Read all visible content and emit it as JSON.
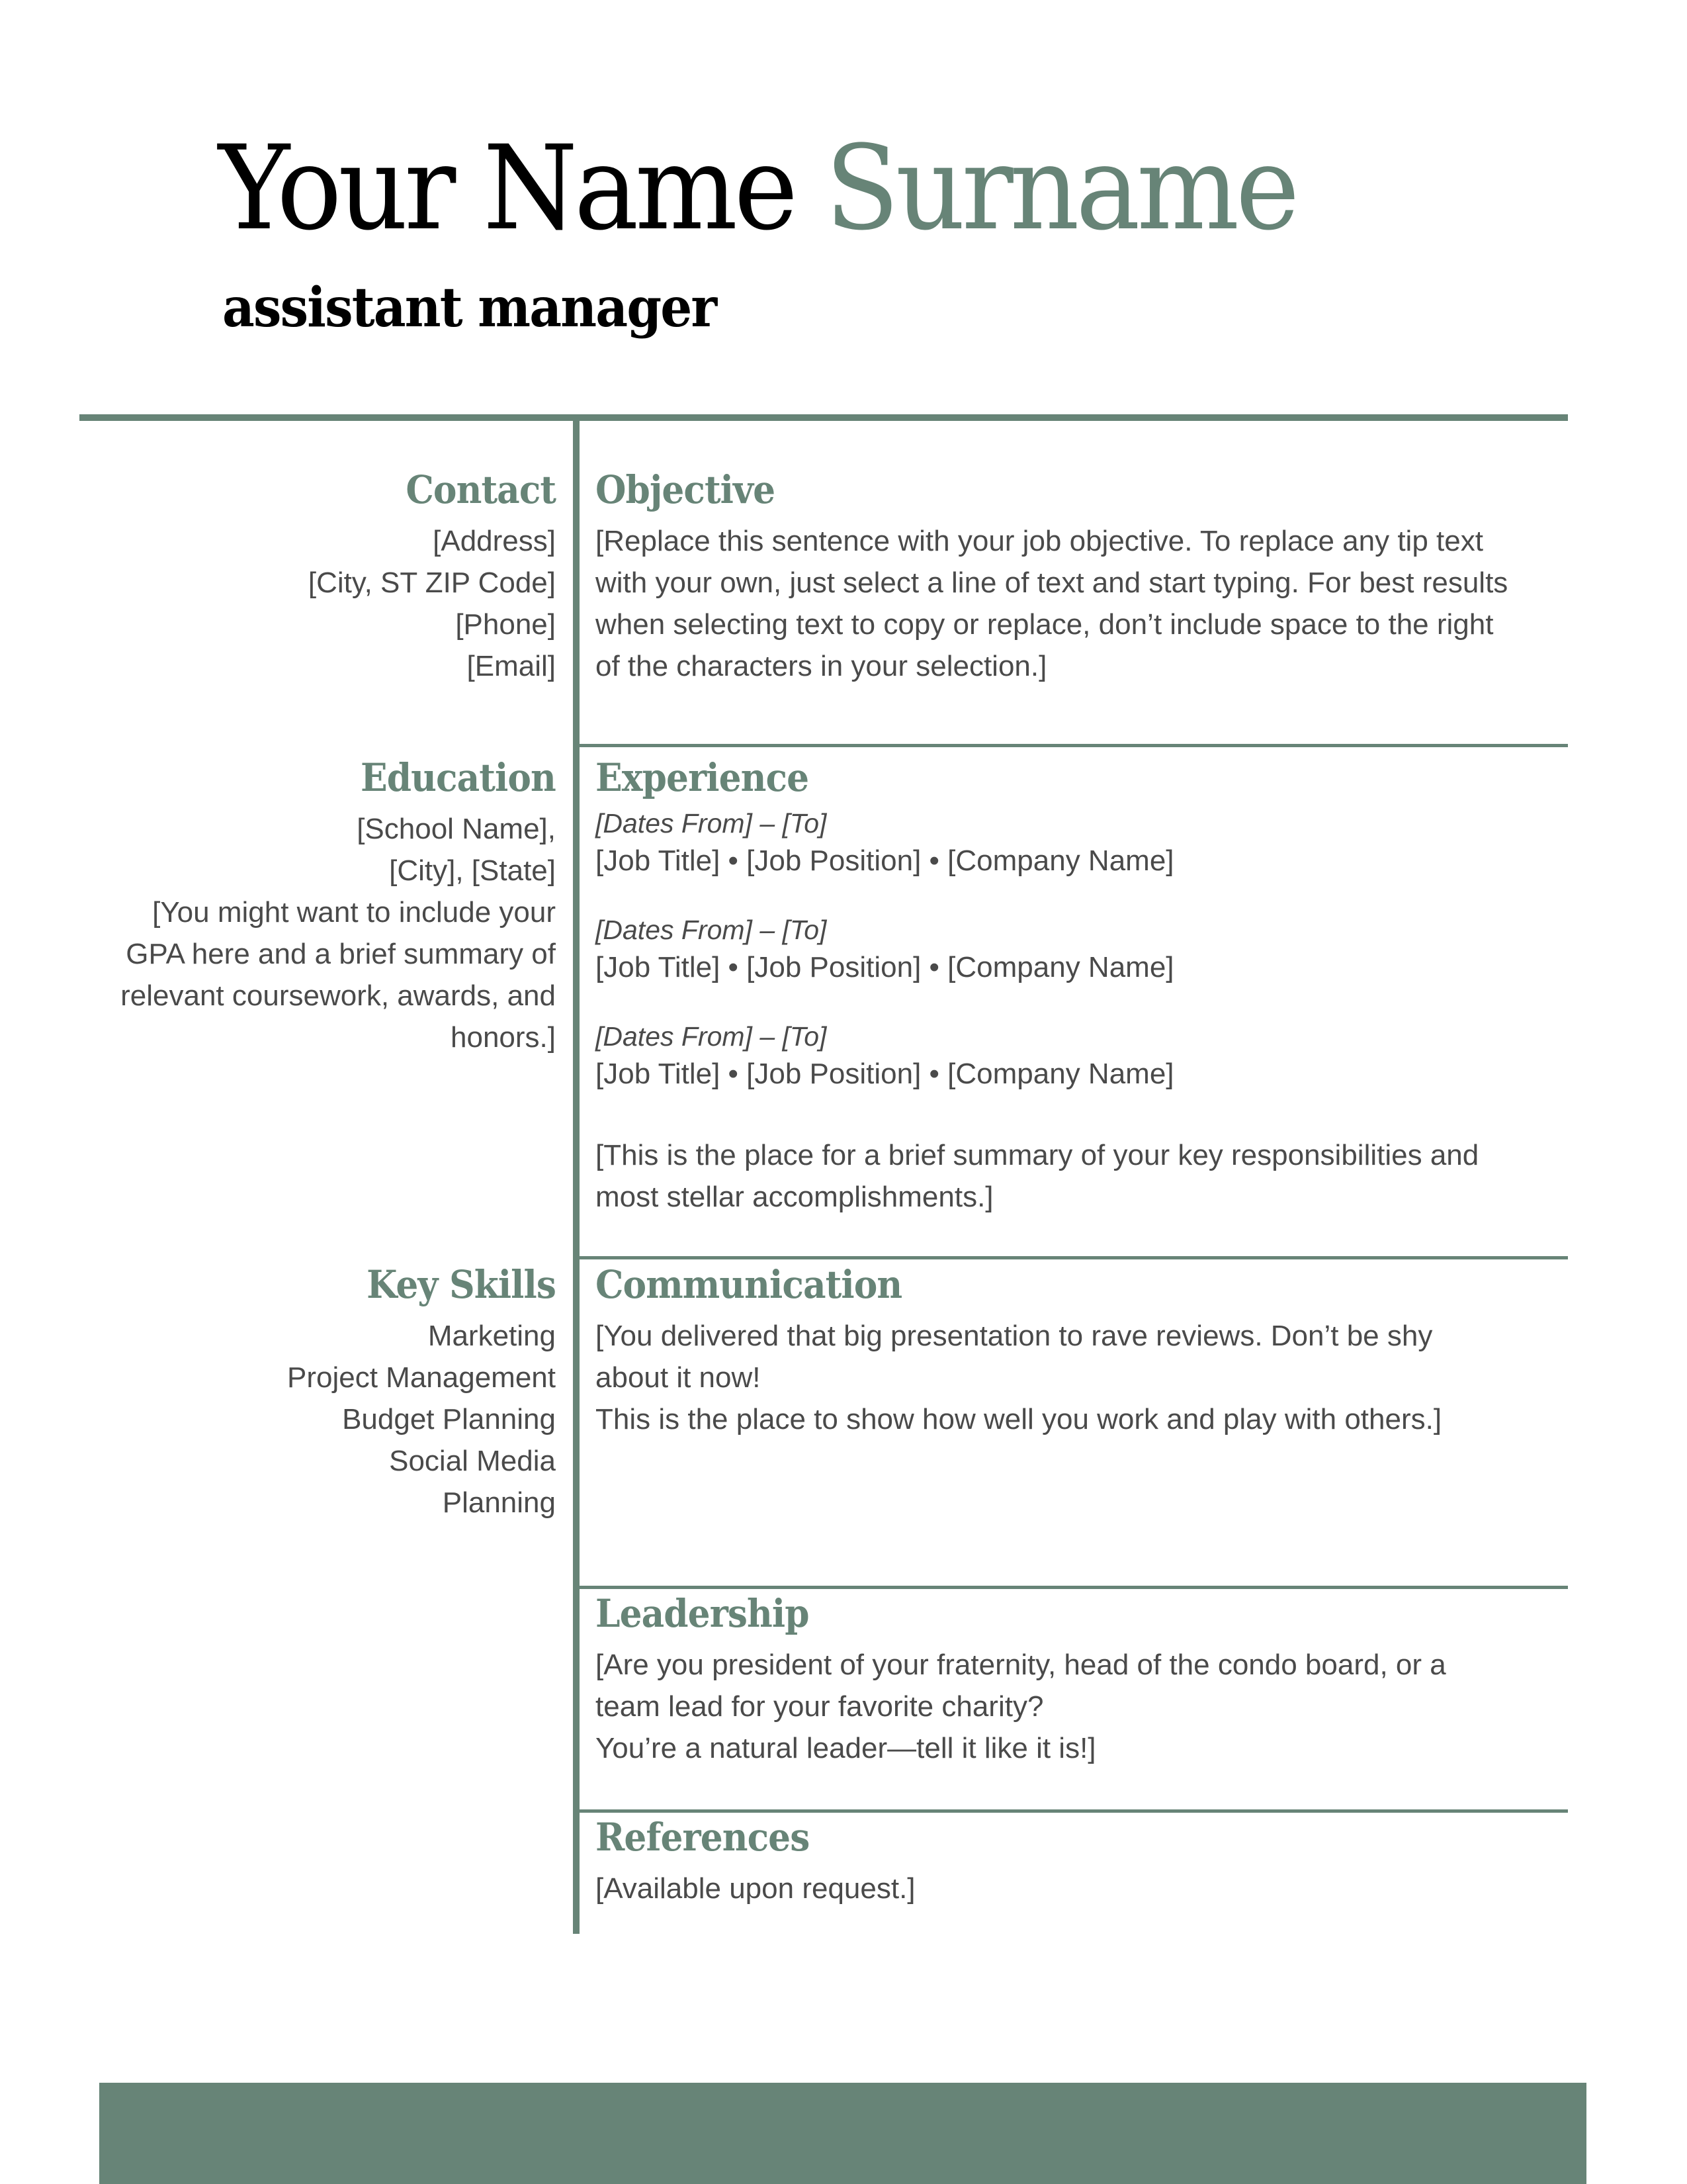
{
  "header": {
    "first_name": "Your Name",
    "surname": "Surname",
    "job_title": "assistant manager"
  },
  "colors": {
    "accent": "#678477",
    "body_text": "#4a4a4a",
    "name_text": "#000000"
  },
  "left_column": {
    "contact": {
      "heading": "Contact",
      "lines": [
        "[Address]",
        "[City, ST ZIP Code]",
        "[Phone]",
        "[Email]"
      ]
    },
    "education": {
      "heading": "Education",
      "lines": [
        "[School Name],",
        "[City], [State]",
        "[You might want to include your",
        "GPA here and a brief summary of",
        "relevant coursework, awards, and",
        "honors.]"
      ]
    },
    "key_skills": {
      "heading": "Key Skills",
      "items": [
        "Marketing",
        "Project Management",
        "Budget Planning",
        "Social Media",
        "Planning"
      ]
    }
  },
  "right_column": {
    "objective": {
      "heading": "Objective",
      "lines": [
        "[Replace this sentence with your job objective. To replace any tip text",
        "with your own, just select a line of text and start typing. For best results",
        "when selecting text to copy or replace, don’t include space to the right",
        "of the characters in your selection.]"
      ]
    },
    "experience": {
      "heading": "Experience",
      "jobs": [
        {
          "dates": "[Dates From] – [To]",
          "details": "[Job Title] • [Job Position] • [Company Name]"
        },
        {
          "dates": "[Dates From] – [To]",
          "details": "[Job Title] • [Job Position] • [Company Name]"
        },
        {
          "dates": "[Dates From] – [To]",
          "details": "[Job Title] • [Job Position] • [Company Name]"
        }
      ],
      "summary_lines": [
        "[This is the place for a brief summary of your key responsibilities and",
        "most stellar accomplishments.]"
      ]
    },
    "communication": {
      "heading": "Communication",
      "lines": [
        "[You delivered that big presentation to rave reviews. Don’t be shy",
        "about it now!",
        "This is the place to show how well you work and play with others.]"
      ]
    },
    "leadership": {
      "heading": "Leadership",
      "lines": [
        "[Are you president of your fraternity, head of the condo board, or a",
        "team lead for your favorite charity?",
        "You’re a natural leader—tell it like it is!]"
      ]
    },
    "references": {
      "heading": "References",
      "lines": [
        "[Available upon request.]"
      ]
    }
  }
}
